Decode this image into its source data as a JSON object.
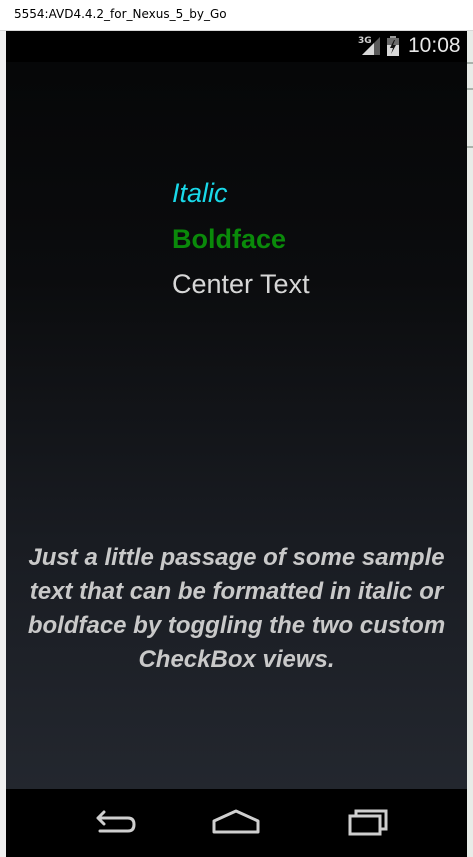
{
  "window": {
    "title": "5554:AVD4.4.2_for_Nexus_5_by_Go"
  },
  "status_bar": {
    "network_type": "3G",
    "time": "10:08",
    "icons": [
      "signal-icon",
      "battery-icon"
    ]
  },
  "content": {
    "italic_label": "Italic",
    "bold_label": "Boldface",
    "center_label": "Center Text",
    "passage": "Just a little passage of some sample text that can be formatted in italic or boldface by toggling the two custom CheckBox views."
  },
  "nav_bar": {
    "buttons": [
      "back-icon",
      "home-icon",
      "recent-apps-icon"
    ]
  },
  "colors": {
    "italic_text": "#19d9e9",
    "bold_text": "#0a8a0a",
    "center_text": "#d7d7d7",
    "passage_text": "#c9c9c9"
  }
}
